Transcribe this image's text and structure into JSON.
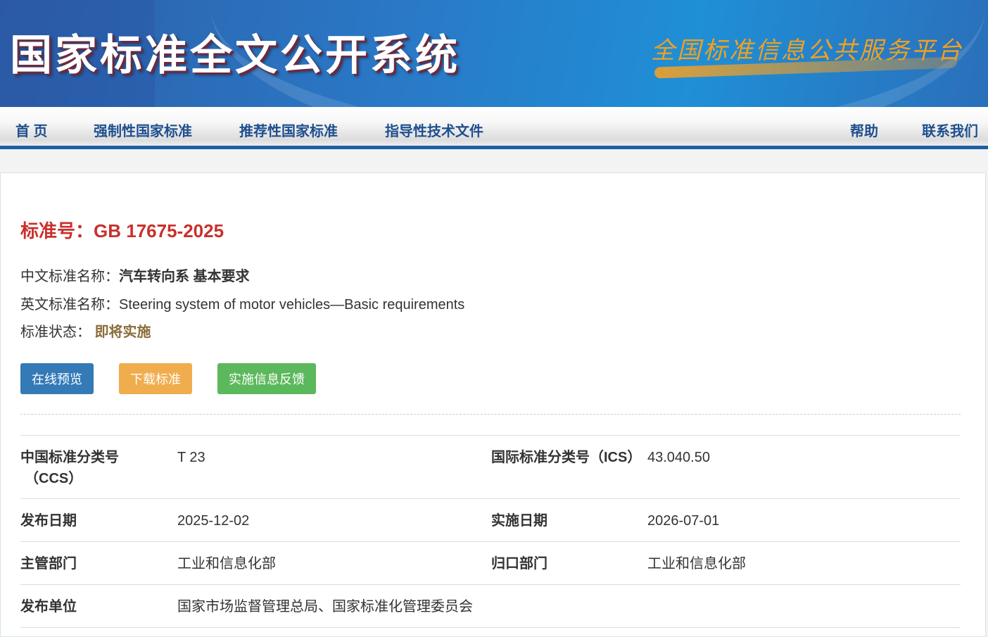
{
  "header": {
    "title": "国家标准全文公开系统",
    "slogan": "全国标准信息公共服务平台"
  },
  "nav": {
    "home": "首 页",
    "mandatory": "强制性国家标准",
    "recommended": "推荐性国家标准",
    "guiding": "指导性技术文件",
    "help": "帮助",
    "contact": "联系我们"
  },
  "standard": {
    "number_label": "标准号：",
    "number": "GB 17675-2025",
    "cn_name_label": "中文标准名称：",
    "cn_name": "汽车转向系 基本要求",
    "en_name_label": "英文标准名称：",
    "en_name": "Steering system of motor vehicles—Basic requirements",
    "status_label": "标准状态：",
    "status": "即将实施"
  },
  "buttons": {
    "preview": "在线预览",
    "download": "下载标准",
    "feedback": "实施信息反馈"
  },
  "details": {
    "ccs_label": "中国标准分类号",
    "ccs_label2": "（CCS）",
    "ccs": "T 23",
    "ics_label": "国际标准分类号（ICS）",
    "ics": "43.040.50",
    "publish_label": "发布日期",
    "publish": "2025-12-02",
    "impl_label": "实施日期",
    "impl": "2026-07-01",
    "dept_label": "主管部门",
    "dept": "工业和信息化部",
    "owner_label": "归口部门",
    "owner": "工业和信息化部",
    "issuer_label": "发布单位",
    "issuer": "国家市场监督管理总局、国家标准化管理委员会"
  },
  "colors": {
    "primary": "#337ab7",
    "warning": "#f0ad4e",
    "success": "#5cb85c",
    "title_red": "#c9302c"
  }
}
